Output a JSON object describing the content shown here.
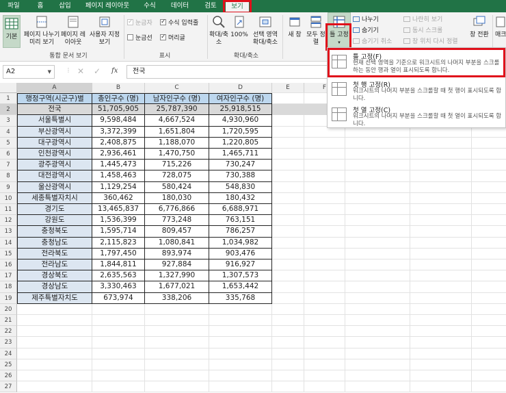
{
  "tabs": [
    "파일",
    "홈",
    "삽입",
    "페이지 레이아웃",
    "수식",
    "데이터",
    "검토",
    "보기"
  ],
  "ribbon": {
    "normal": "기본",
    "page_break": "페이지 나누기 미리 보기",
    "page_layout": "페이지 레이아웃",
    "custom_view": "사용자 지정 보기",
    "group_workbook_views": "통합 문서 보기",
    "ruler": "눈금자",
    "formula_bar": "수식 입력줄",
    "gridlines": "눈금선",
    "headings": "머리글",
    "group_show": "표시",
    "zoom": "확대/축소",
    "zoom_100": "100%",
    "zoom_selection": "선택 영역 확대/축소",
    "group_zoom": "확대/축소",
    "new_window": "새 창",
    "arrange_all": "모두 정렬",
    "freeze_panes": "틀 고정",
    "split": "나누기",
    "hide": "숨기기",
    "unhide": "숨기기 취소",
    "side_by_side": "나란히 보기",
    "sync_scroll": "동시 스크롤",
    "reset_position": "창 위치 다시 정렬",
    "switch_windows": "창 전환",
    "macros": "매크"
  },
  "formula_bar": {
    "name_box": "A2",
    "content": "전국",
    "fx": "fx"
  },
  "columns": [
    "A",
    "B",
    "C",
    "D",
    "E",
    "F"
  ],
  "table": {
    "headers": [
      "행정구역(시군구)별",
      "총인구수 (명)",
      "남자인구수 (명)",
      "여자인구수 (명)"
    ],
    "rows": [
      [
        "전국",
        "51,705,905",
        "25,787,390",
        "25,918,515"
      ],
      [
        "서울특별시",
        "9,598,484",
        "4,667,524",
        "4,930,960"
      ],
      [
        "부산광역시",
        "3,372,399",
        "1,651,804",
        "1,720,595"
      ],
      [
        "대구광역시",
        "2,408,875",
        "1,188,070",
        "1,220,805"
      ],
      [
        "인천광역시",
        "2,936,461",
        "1,470,750",
        "1,465,711"
      ],
      [
        "광주광역시",
        "1,445,473",
        "715,226",
        "730,247"
      ],
      [
        "대전광역시",
        "1,458,463",
        "728,075",
        "730,388"
      ],
      [
        "울산광역시",
        "1,129,254",
        "580,424",
        "548,830"
      ],
      [
        "세종특별자치시",
        "360,462",
        "180,030",
        "180,432"
      ],
      [
        "경기도",
        "13,465,837",
        "6,776,866",
        "6,688,971"
      ],
      [
        "강원도",
        "1,536,399",
        "773,248",
        "763,151"
      ],
      [
        "충청북도",
        "1,595,714",
        "809,457",
        "786,257"
      ],
      [
        "충청남도",
        "2,115,823",
        "1,080,841",
        "1,034,982"
      ],
      [
        "전라북도",
        "1,797,450",
        "893,974",
        "903,476"
      ],
      [
        "전라남도",
        "1,844,811",
        "927,884",
        "916,927"
      ],
      [
        "경상북도",
        "2,635,563",
        "1,327,990",
        "1,307,573"
      ],
      [
        "경상남도",
        "3,330,463",
        "1,677,021",
        "1,653,442"
      ],
      [
        "제주특별자치도",
        "673,974",
        "338,206",
        "335,768"
      ]
    ]
  },
  "row_numbers": [
    "1",
    "2",
    "3",
    "4",
    "5",
    "6",
    "7",
    "8",
    "9",
    "10",
    "11",
    "12",
    "13",
    "14",
    "15",
    "16",
    "17",
    "18",
    "19",
    "20",
    "21",
    "22",
    "23",
    "24",
    "25",
    "26",
    "27"
  ],
  "menu": {
    "items": [
      {
        "title": "틀 고정(F)",
        "desc": "현재 선택 영역을 기준으로 워크시트의 나머지 부분을 스크롤하는 동안 행과 열이 표시되도록 합니다."
      },
      {
        "title": "첫 행 고정(R)",
        "desc": "워크시트의 나머지 부분을 스크롤할 때 첫 행이 표시되도록 합니다."
      },
      {
        "title": "첫 열 고정(C)",
        "desc": "워크시트의 나머지 부분을 스크롤할 때 첫 열이 표시되도록 합니다."
      }
    ]
  },
  "colors": {
    "excel_green": "#217346",
    "highlight_red": "#e0101b",
    "header_blue": "#bdd7ee",
    "region_blue": "#dce6f1",
    "total_gray": "#d9d9d9"
  }
}
